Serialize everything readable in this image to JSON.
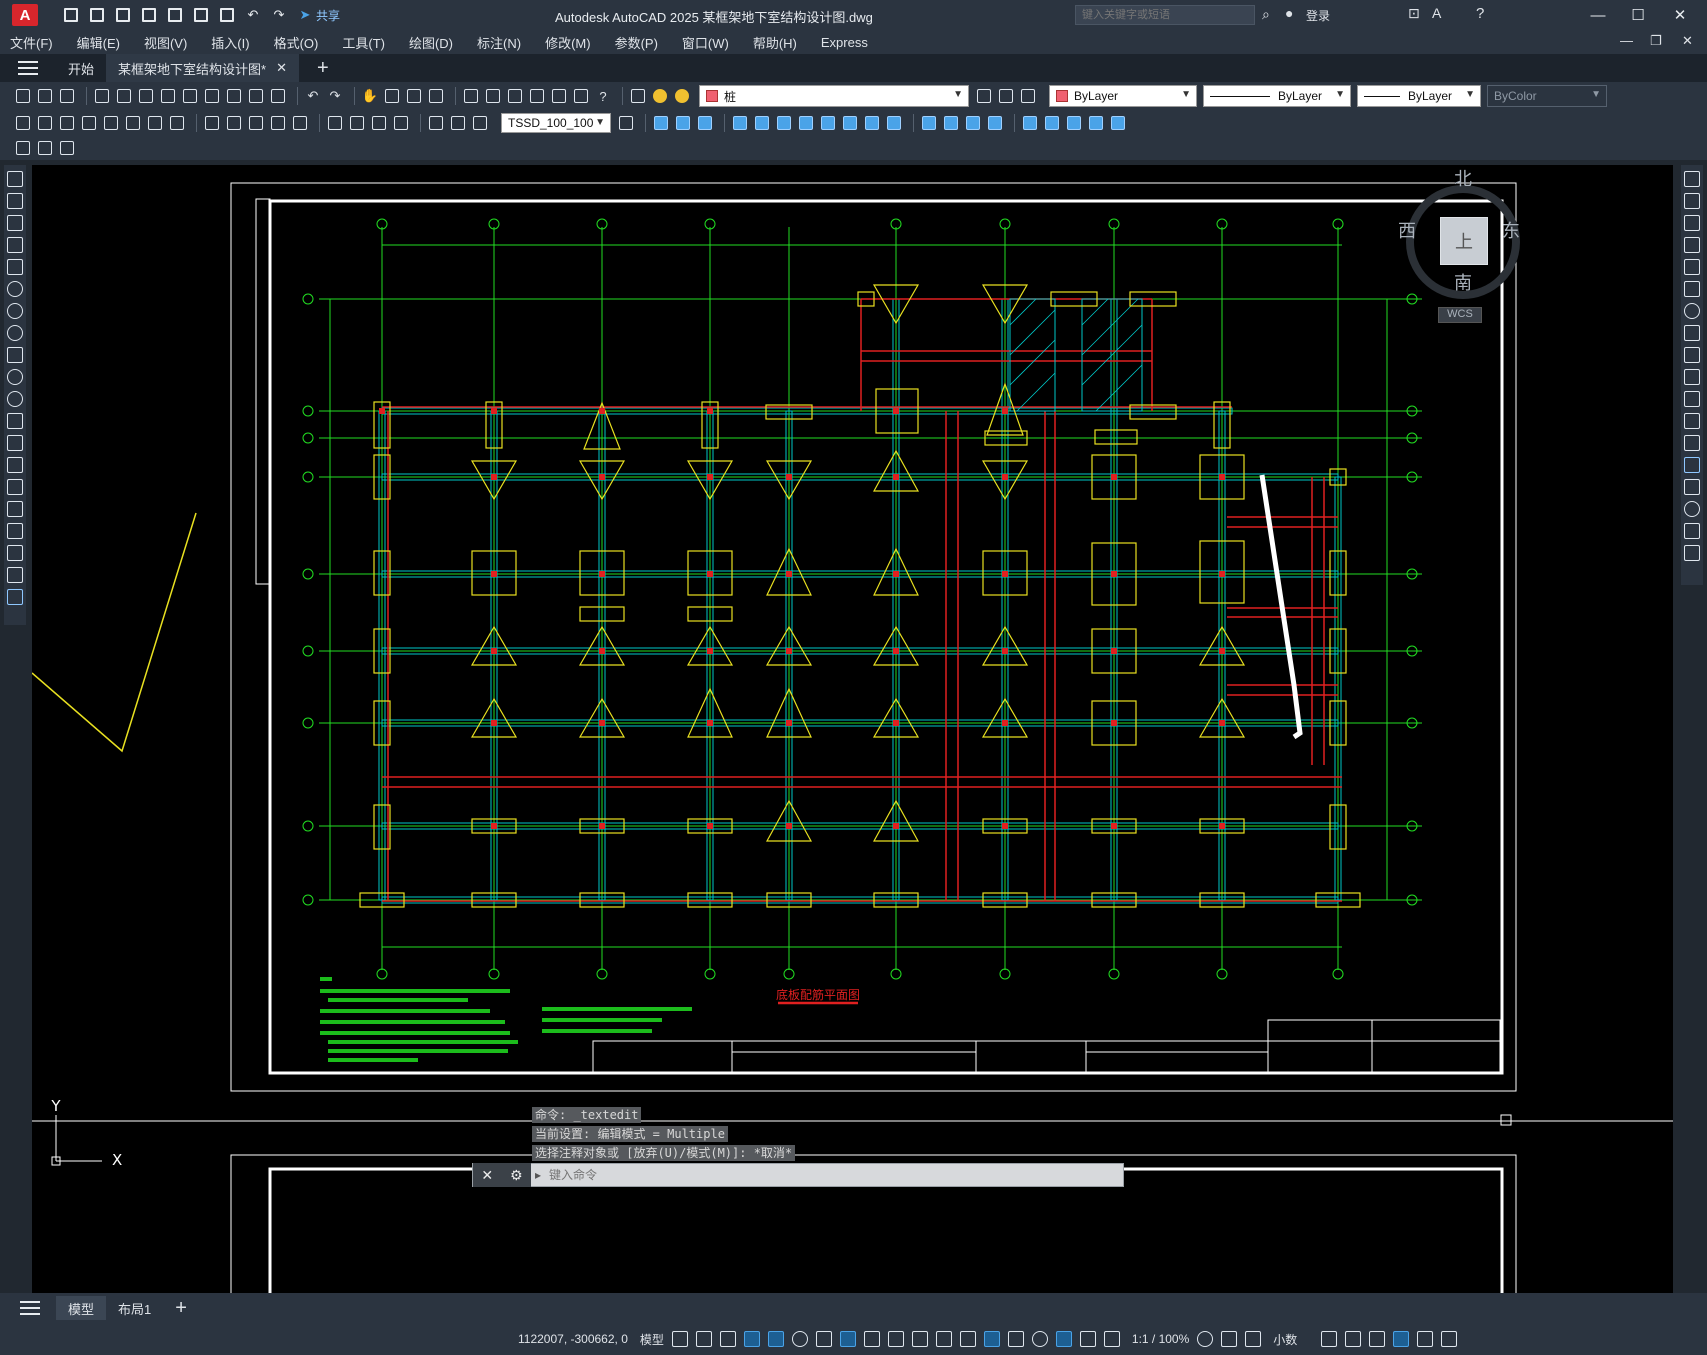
{
  "app": {
    "logo": "A",
    "title": "Autodesk AutoCAD 2025    某框架地下室结构设计图.dwg",
    "search_placeholder": "键入关键字或短语",
    "login": "登录",
    "share": "共享"
  },
  "menu": [
    "文件(F)",
    "编辑(E)",
    "视图(V)",
    "插入(I)",
    "格式(O)",
    "工具(T)",
    "绘图(D)",
    "标注(N)",
    "修改(M)",
    "参数(P)",
    "窗口(W)",
    "帮助(H)",
    "Express"
  ],
  "tabs": {
    "start": "开始",
    "active": "某框架地下室结构设计图*"
  },
  "properties": {
    "layer": "桩",
    "color": "ByLayer",
    "linetype": "ByLayer",
    "lineweight": "ByLayer",
    "plotstyle": "ByColor",
    "dimstyle": "TSSD_100_100"
  },
  "viewcube": {
    "north": "北",
    "south": "南",
    "east": "东",
    "west": "西",
    "top": "上",
    "wcs": "WCS"
  },
  "drawing": {
    "plan_title": "底板配筋平面图",
    "ucs_y": "Y",
    "ucs_x": "X"
  },
  "command": {
    "history": [
      "命令: _textedit",
      "当前设置: 编辑模式 = Multiple",
      "选择注释对象或 [放弃(U)/模式(M)]: *取消*"
    ],
    "placeholder": "键入命令"
  },
  "layout_tabs": [
    "模型",
    "布局1"
  ],
  "status": {
    "coords": "1122007, -300662, 0",
    "model": "模型",
    "scale": "1:1 / 100%",
    "units": "小数"
  },
  "colors": {
    "grid_axis": "#22dd22",
    "beam": "#00c8c8",
    "rebar": "#e02020",
    "footing": "#e8e020",
    "frame": "#ffffff"
  }
}
